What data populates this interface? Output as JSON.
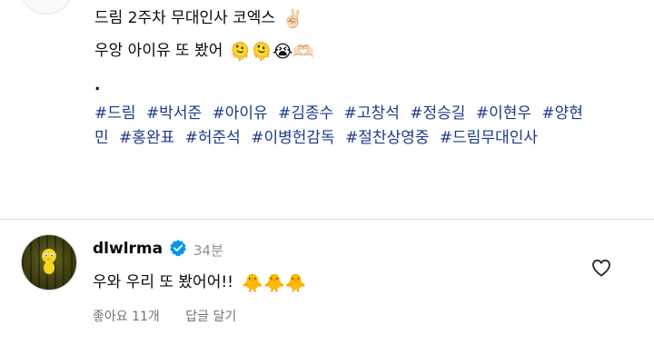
{
  "post": {
    "caption_line1": "드림 2주차 무대인사 코엑스",
    "caption_line1_emoji": "✌🏻",
    "caption_line2": "우앙 아이유 또 봤어",
    "caption_line2_emoji": "🫠🫠😭🫶🏻",
    "caption_line3": ".",
    "hashtags": [
      "#드림",
      "#박서준",
      "#아이유",
      "#김종수",
      "#고창석",
      "#정승길",
      "#이현우",
      "#양현민",
      "#홍완표",
      "#허준석",
      "#이병헌감독",
      "#절찬상영중",
      "#드림무대인사"
    ]
  },
  "comment": {
    "username": "dlwlrma",
    "time": "34분",
    "text": "우와 우리 또 봤어어!!",
    "emoji": "🐥🐥🐥",
    "likes_label": "좋아요 11개",
    "reply_label": "답글 달기"
  },
  "colors": {
    "hashtag": "#1e3a8a",
    "verified": "#0095f6",
    "muted": "#8e8e8e"
  }
}
